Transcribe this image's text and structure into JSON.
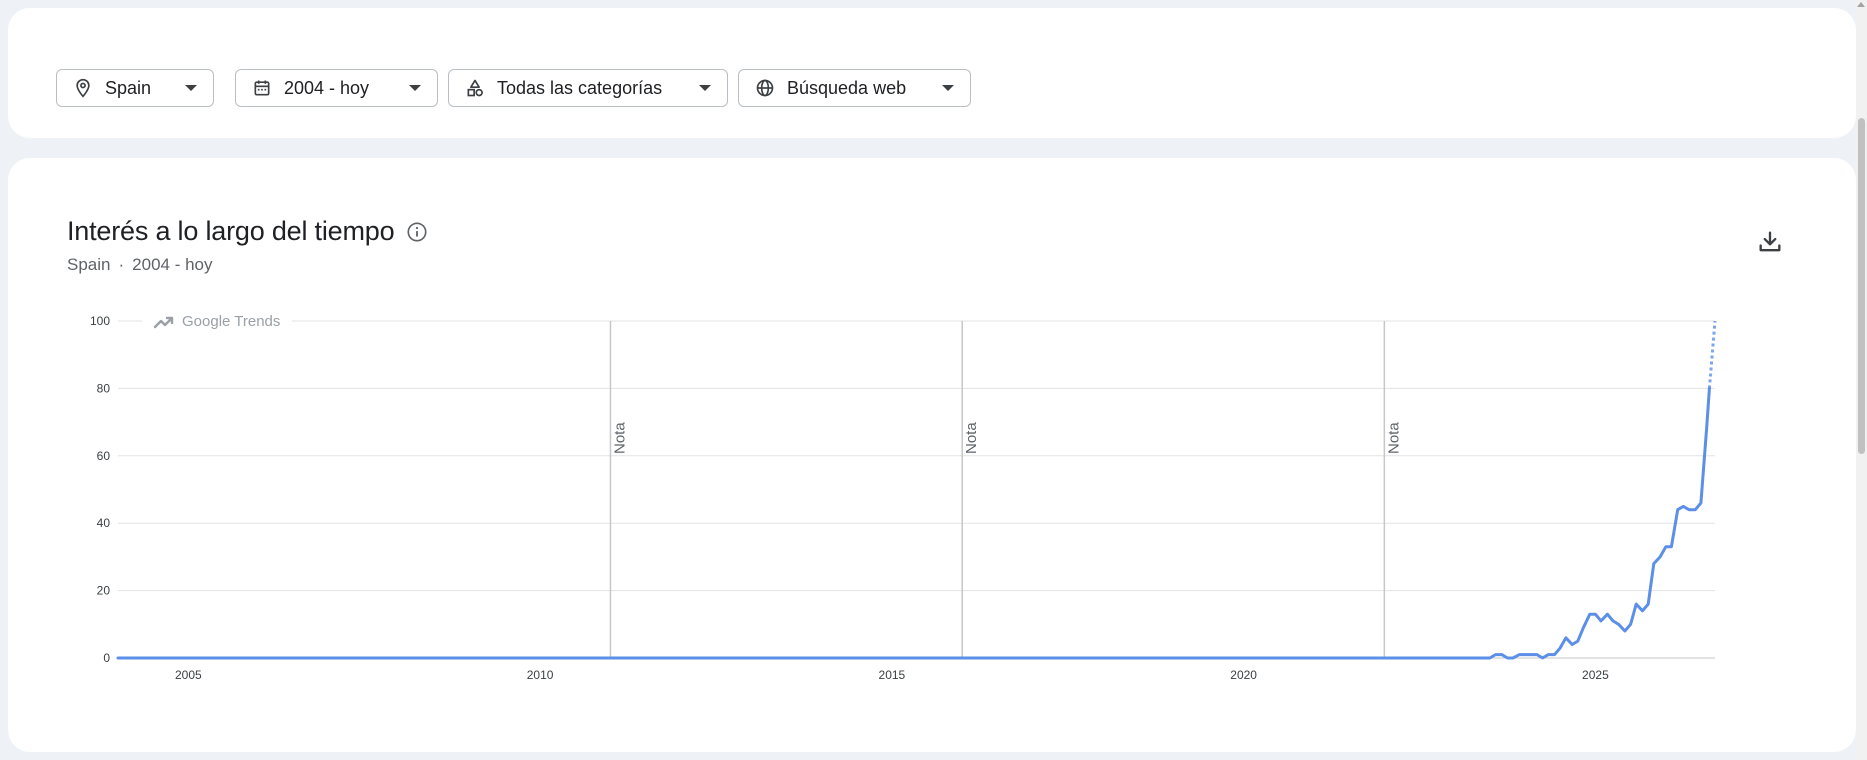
{
  "filters": [
    {
      "label": "Spain",
      "icon": "location-pin-icon"
    },
    {
      "label": "2004 - hoy",
      "icon": "calendar-icon"
    },
    {
      "label": "Todas las categorías",
      "icon": "category-shapes-icon"
    },
    {
      "label": "Búsqueda web",
      "icon": "globe-icon"
    }
  ],
  "panel": {
    "title": "Interés a lo largo del tiempo",
    "subtitle_region": "Spain",
    "subtitle_separator": "·",
    "subtitle_period": "2004 - hoy",
    "watermark": "Google Trends",
    "note_label": "Nota"
  },
  "colors": {
    "line": "#5b8fe8",
    "grid": "#e3e3e3",
    "note_line": "#c7c7c7",
    "axis": "#c7c7c7"
  },
  "chart_data": {
    "type": "line",
    "title": "Interés a lo largo del tiempo",
    "xlabel": "",
    "ylabel": "",
    "xlim": [
      2004.0,
      2026.7
    ],
    "ylim": [
      0,
      100
    ],
    "yticks": [
      0,
      20,
      40,
      60,
      80,
      100
    ],
    "xticks": [
      2005,
      2010,
      2015,
      2020,
      2025
    ],
    "grid": true,
    "notes": [
      2011.0,
      2016.0,
      2022.0
    ],
    "partial_from": 2026.62,
    "series": [
      {
        "name": "",
        "x": [
          2004.0,
          2023.5,
          2023.58,
          2023.67,
          2023.75,
          2023.83,
          2023.92,
          2024.0,
          2024.08,
          2024.17,
          2024.25,
          2024.33,
          2024.42,
          2024.5,
          2024.58,
          2024.67,
          2024.75,
          2024.83,
          2024.92,
          2025.0,
          2025.08,
          2025.17,
          2025.25,
          2025.33,
          2025.42,
          2025.5,
          2025.58,
          2025.67,
          2025.75,
          2025.83,
          2025.92,
          2026.0,
          2026.08,
          2026.17,
          2026.25,
          2026.33,
          2026.42,
          2026.5,
          2026.58,
          2026.62,
          2026.7
        ],
        "values": [
          0,
          0,
          1,
          1,
          0,
          0,
          1,
          1,
          1,
          1,
          0,
          1,
          1,
          3,
          6,
          4,
          5,
          9,
          13,
          13,
          11,
          13,
          11,
          10,
          8,
          10,
          16,
          14,
          16,
          28,
          30,
          33,
          33,
          44,
          45,
          44,
          44,
          46,
          68,
          80,
          100
        ]
      }
    ]
  }
}
